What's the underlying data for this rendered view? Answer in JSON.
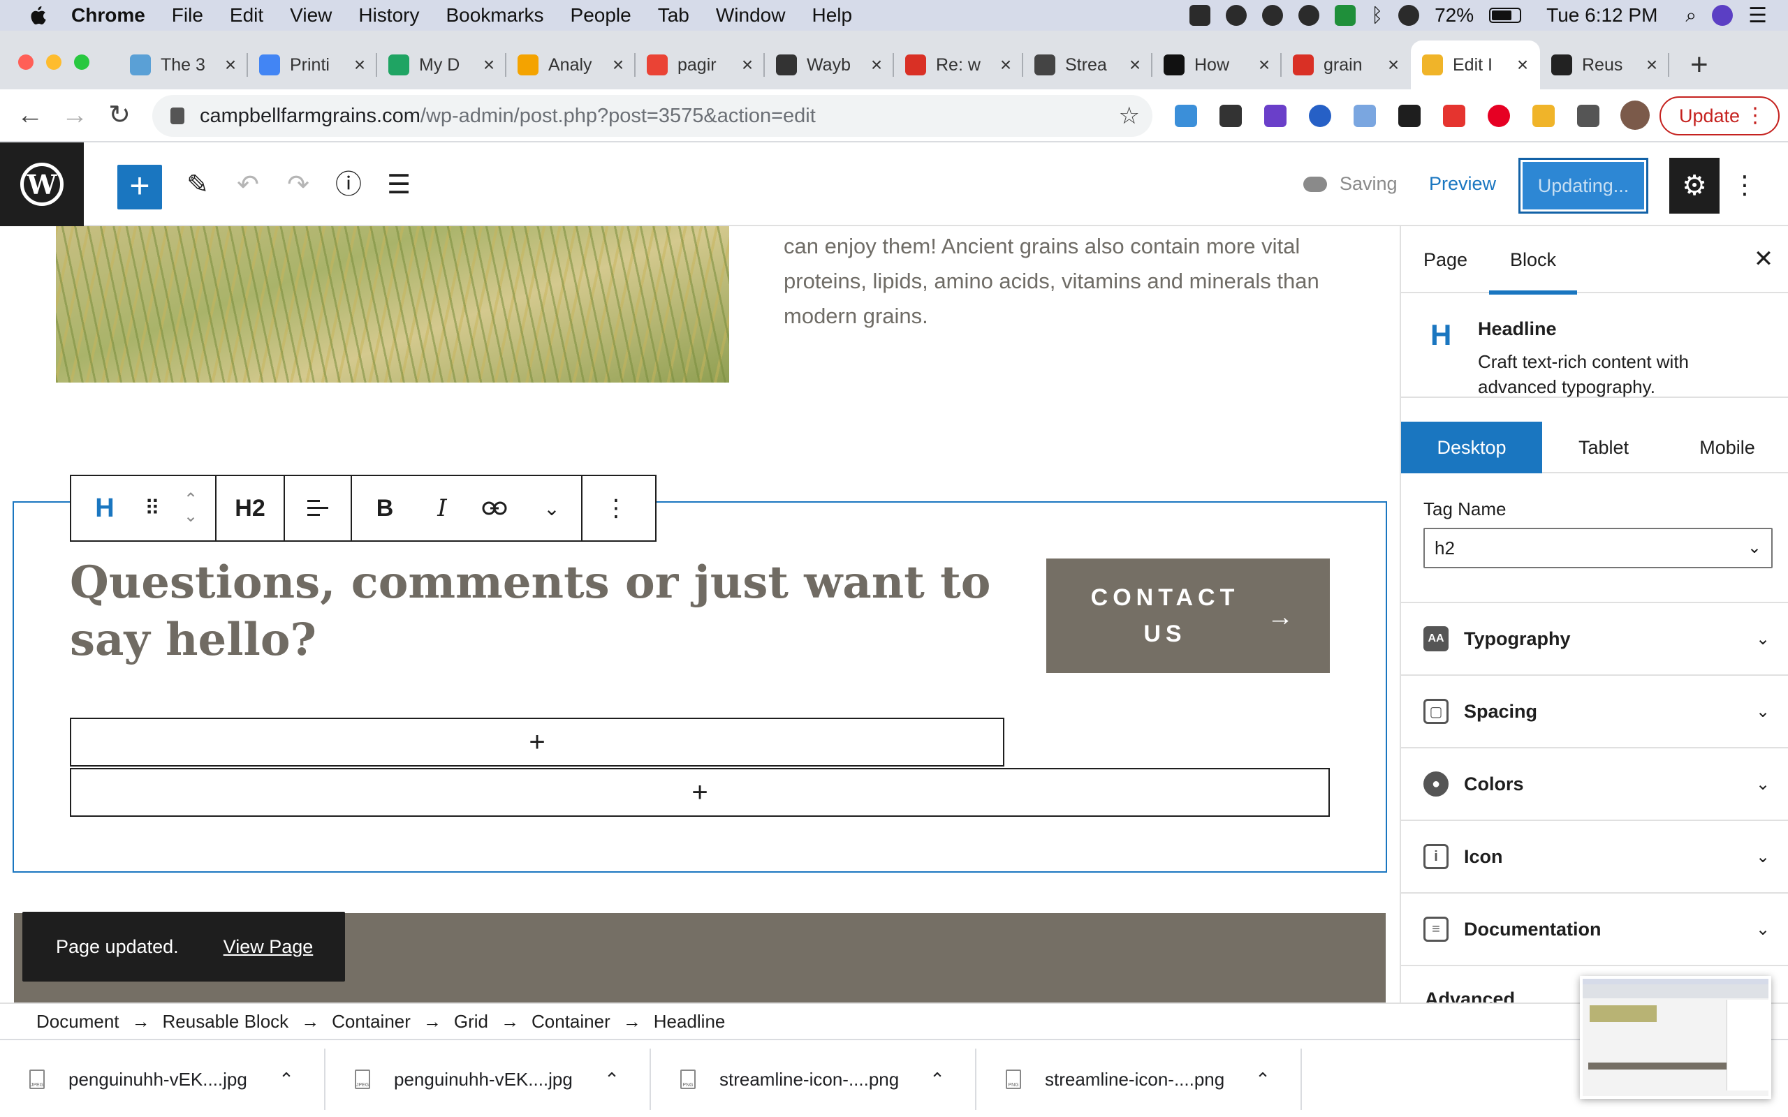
{
  "menubar": {
    "app": "Chrome",
    "items": [
      "File",
      "Edit",
      "View",
      "History",
      "Bookmarks",
      "People",
      "Tab",
      "Window",
      "Help"
    ],
    "battery": "72%",
    "clock": "Tue 6:12 PM"
  },
  "tabs": [
    {
      "title": "The 3",
      "color": "#5aa0d6"
    },
    {
      "title": "Printi",
      "color": "#4285f4"
    },
    {
      "title": "My D",
      "color": "#1fa463"
    },
    {
      "title": "Analy",
      "color": "#f4a300"
    },
    {
      "title": "pagir",
      "color": "#ea4335"
    },
    {
      "title": "Wayb",
      "color": "#333333"
    },
    {
      "title": "Re: w",
      "color": "#d93025"
    },
    {
      "title": "Strea",
      "color": "#444444"
    },
    {
      "title": "How",
      "color": "#111111"
    },
    {
      "title": "grain",
      "color": "#d93025"
    },
    {
      "title": "Edit I",
      "color": "#f0b429"
    },
    {
      "title": "Reus",
      "color": "#222222"
    }
  ],
  "browser": {
    "url_host": "campbellfarmgrains.com",
    "url_path": "/wp-admin/post.php?post=3575&action=edit",
    "update_label": "Update",
    "new_tab": "+"
  },
  "editor": {
    "saving": "Saving",
    "preview": "Preview",
    "updating": "Updating..."
  },
  "content": {
    "intro": "can enjoy them! Ancient grains also contain more vital proteins, lipids, amino acids, vitamins and minerals than modern grains.",
    "headline": "Questions, comments or just want to say hello?",
    "contact_line1": "CONTACT",
    "contact_line2": "US",
    "contact_arrow": "→",
    "appender": "+"
  },
  "block_toolbar": {
    "block_icon": "H",
    "heading_level": "H2",
    "bold": "B",
    "italic": "I"
  },
  "snackbar": {
    "message": "Page updated.",
    "link": "View Page"
  },
  "sidebar": {
    "tabs": [
      "Page",
      "Block"
    ],
    "active_tab": "Block",
    "block_title": "Headline",
    "block_desc": "Craft text-rich content with advanced typography.",
    "device_tabs": [
      "Desktop",
      "Tablet",
      "Mobile"
    ],
    "active_device": "Desktop",
    "tag_label": "Tag Name",
    "tag_value": "h2",
    "panels": [
      "Typography",
      "Spacing",
      "Colors",
      "Icon",
      "Documentation"
    ],
    "advanced": "Advanced"
  },
  "breadcrumbs": [
    "Document",
    "Reusable Block",
    "Container",
    "Grid",
    "Container",
    "Headline"
  ],
  "downloads": [
    {
      "file": "penguinuhh-vEK....jpg",
      "type": "JPEG"
    },
    {
      "file": "penguinuhh-vEK....jpg",
      "type": "JPEG"
    },
    {
      "file": "streamline-icon-....png",
      "type": "PNG"
    },
    {
      "file": "streamline-icon-....png",
      "type": "PNG"
    }
  ],
  "colors": {
    "wp_blue": "#1a76c0",
    "button_taupe": "#756f65",
    "chrome_update_red": "#c5221f"
  }
}
